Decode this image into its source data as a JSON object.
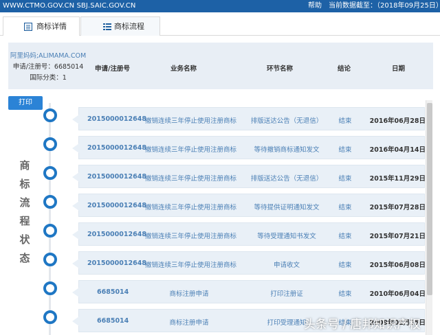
{
  "topbar": {
    "sites": "WWW.CTMO.GOV.CN SBJ.SAIC.GOV.CN",
    "help": "帮助",
    "data_cutoff": "当前数据截至：（2018年09月25日）"
  },
  "tabs": [
    {
      "label": "商标详情",
      "icon": "document-icon"
    },
    {
      "label": "商标流程",
      "icon": "list-icon"
    }
  ],
  "info": {
    "owner": "阿里妈妈;ALIMAMA.COM",
    "reg_no": "申请/注册号：6685014",
    "intl_class": "国际分类：1"
  },
  "columns": [
    "申请/注册号",
    "业务名称",
    "环节名称",
    "结论",
    "日期"
  ],
  "print_label": "打印",
  "side_title": [
    "商",
    "标",
    "流",
    "程",
    "状",
    "态"
  ],
  "rows": [
    {
      "reg": "2015000012648",
      "business": "撤销连续三年停止使用注册商标",
      "step": "排版送达公告（无退信）",
      "result": "结束",
      "date": "2016年06月28日"
    },
    {
      "reg": "2015000012648",
      "business": "撤销连续三年停止使用注册商标",
      "step": "等待撤销商标通知发文",
      "result": "结束",
      "date": "2016年04月14日"
    },
    {
      "reg": "2015000012648",
      "business": "撤销连续三年停止使用注册商标",
      "step": "排版送达公告（无退信）",
      "result": "结束",
      "date": "2015年11月29日"
    },
    {
      "reg": "2015000012648",
      "business": "撤销连续三年停止使用注册商标",
      "step": "等待提供证明通知发文",
      "result": "结束",
      "date": "2015年07月28日"
    },
    {
      "reg": "2015000012648",
      "business": "撤销连续三年停止使用注册商标",
      "step": "等待受理通知书发文",
      "result": "结束",
      "date": "2015年07月21日"
    },
    {
      "reg": "2015000012648",
      "business": "撤销连续三年停止使用注册商标",
      "step": "申请收文",
      "result": "结束",
      "date": "2015年06月08日"
    },
    {
      "reg": "6685014",
      "business": "商标注册申请",
      "step": "打印注册证",
      "result": "结束",
      "date": "2010年06月04日"
    },
    {
      "reg": "6685014",
      "business": "商标注册申请",
      "step": "打印受理通知",
      "result": "结束",
      "date": "2009年01月15日"
    }
  ],
  "watermark": "头条号 / 唐邦知识产权",
  "colors": {
    "topbar": "#1d61a6",
    "accent": "#1f77c4",
    "row_bg": "#e9f0f7",
    "header_bg": "#e8eef5",
    "link": "#4a7fb5"
  }
}
